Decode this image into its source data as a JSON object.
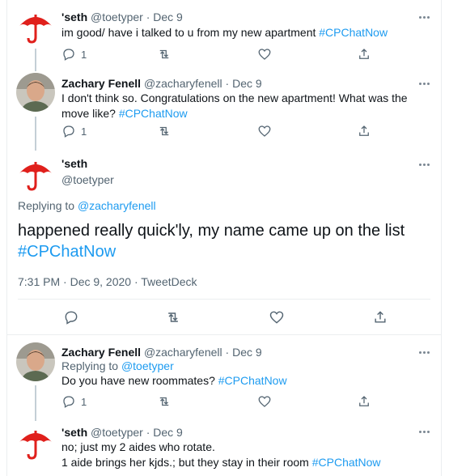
{
  "tweets": [
    {
      "name": "'seth",
      "handle": "@toetyper",
      "date": "· Dec 9",
      "text_prefix": "im good/ have i talked to u from my  new apartment  ",
      "hashtag": "#CPChatNow",
      "reply_count": "1"
    },
    {
      "name": "Zachary Fenell",
      "handle": "@zacharyfenell",
      "date": "· Dec 9",
      "text_prefix": "I don't think so. Congratulations on the new apartment! What was the move like? ",
      "hashtag": "#CPChatNow",
      "reply_count": "1"
    }
  ],
  "focused": {
    "name": "'seth",
    "handle": "@toetyper",
    "replying_label": "Replying to ",
    "replying_to": "@zacharyfenell",
    "text": "happened really quick'ly, my  name came up on the list",
    "hashtag": "#CPChatNow",
    "timestamp": "7:31 PM · Dec 9, 2020 · TweetDeck"
  },
  "replies": [
    {
      "name": "Zachary Fenell",
      "handle": "@zacharyfenell",
      "date": "· Dec 9",
      "replying_label": "Replying to ",
      "replying_to": "@toetyper",
      "text_prefix": "Do you have new roommates? ",
      "hashtag": "#CPChatNow",
      "reply_count": "1"
    },
    {
      "name": "'seth",
      "handle": "@toetyper",
      "date": "· Dec 9",
      "line1": "no; just my 2  aides who rotate.",
      "line2_prefix": "1 aide brings her kjds.; but they stay in their room  ",
      "hashtag": "#CPChatNow"
    }
  ],
  "icons": {
    "reply": "reply-icon",
    "retweet": "retweet-icon",
    "like": "heart-icon",
    "share": "share-icon",
    "more": "more-icon",
    "avatar_seth": "red-umbrella-avatar",
    "avatar_zach": "person-photo-avatar"
  },
  "colors": {
    "accent": "#1d9bf0",
    "umbrella": "#e0201c",
    "secondary_text": "#536471"
  }
}
